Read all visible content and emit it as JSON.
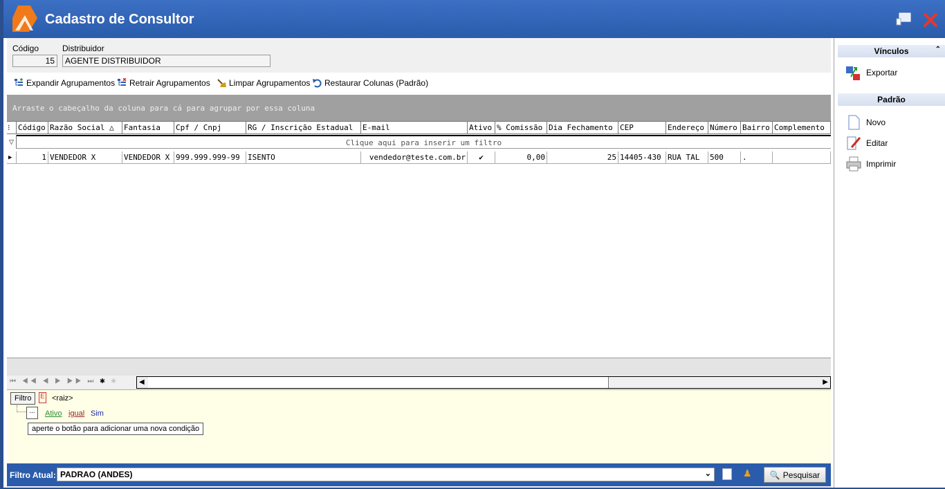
{
  "window": {
    "title": "Cadastro de Consultor"
  },
  "form": {
    "codigo_label": "Código",
    "codigo_value": "15",
    "distribuidor_label": "Distribuidor",
    "distribuidor_value": "AGENTE DISTRIBUIDOR"
  },
  "toolbar": {
    "expand": "Expandir Agrupamentos",
    "collapse": "Retrair Agrupamentos",
    "clear": "Limpar Agrupamentos",
    "restore": "Restaurar Colunas (Padrão)"
  },
  "grid": {
    "group_hint": "Arraste o cabeçalho da coluna para cá para agrupar por essa coluna",
    "filter_hint": "Clique aqui para inserir um filtro",
    "columns": [
      "Código",
      "Razão Social △",
      "Fantasia",
      "Cpf / Cnpj",
      "RG / Inscrição Estadual",
      "E-mail",
      "Ativo",
      "% Comissão",
      "Dia Fechamento",
      "CEP",
      "Endereço",
      "Número",
      "Bairro",
      "Complemento"
    ],
    "rows": [
      {
        "codigo": "1",
        "razao": "VENDEDOR X",
        "fantasia": "VENDEDOR X",
        "cpf": "999.999.999-99",
        "rg": "ISENTO",
        "email": "vendedor@teste.com.br",
        "ativo": "✔",
        "comissao": "0,00",
        "dia": "25",
        "cep": "14405-430",
        "endereco": "RUA TAL",
        "numero": "500",
        "bairro": ".",
        "complemento": ""
      }
    ]
  },
  "filter": {
    "button": "Filtro",
    "root": "<raiz>",
    "cond_field": "Ativo",
    "cond_op": "igual",
    "cond_value": "Sim",
    "add_btn": "...",
    "tooltip": "aperte o botão para adicionar uma nova condição"
  },
  "status": {
    "label": "Filtro Atual:",
    "current": "PADRAO (ANDES)",
    "search": "Pesquisar"
  },
  "side": {
    "vinculos": "Vínculos",
    "exportar": "Exportar",
    "padrao": "Padrão",
    "novo": "Novo",
    "editar": "Editar",
    "imprimir": "Imprimir"
  },
  "colors": {
    "titlebar": "#2a5cab",
    "accent": "#f07a1a",
    "close": "#e8372a"
  }
}
